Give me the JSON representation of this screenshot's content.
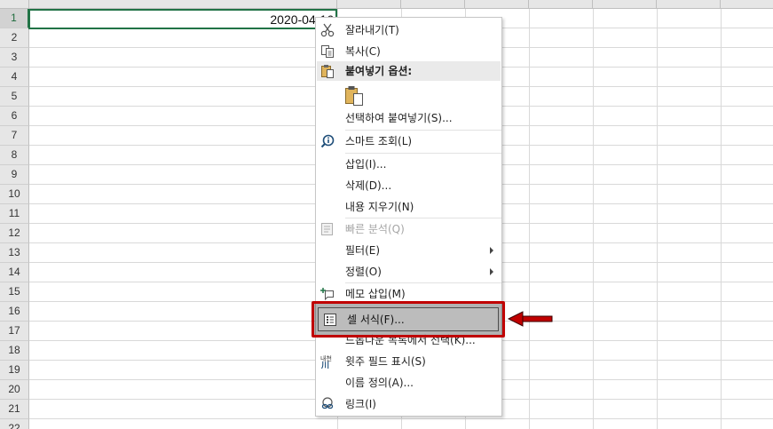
{
  "sheet": {
    "column_headers": [
      "",
      "",
      "",
      "",
      "",
      "",
      "",
      "",
      ""
    ],
    "row_numbers": [
      "1",
      "2",
      "3",
      "4",
      "5",
      "6",
      "7",
      "8",
      "9",
      "10",
      "11",
      "12",
      "13",
      "14",
      "15",
      "16",
      "17",
      "18",
      "19",
      "20",
      "21",
      "22"
    ],
    "active_cell_value": "2020-04-16"
  },
  "context_menu": {
    "cut": "잘라내기(T)",
    "copy": "복사(C)",
    "paste_options": "붙여넣기 옵션:",
    "paste_special": "선택하여 붙여넣기(S)...",
    "smart_lookup": "스마트 조회(L)",
    "insert": "삽입(I)...",
    "delete": "삭제(D)...",
    "clear_contents": "내용 지우기(N)",
    "quick_analysis": "빠른 분석(Q)",
    "filter": "필터(E)",
    "sort": "정렬(O)",
    "insert_comment": "메모 삽입(M)",
    "format_cells": "셀 서식(F)...",
    "pick_from_list": "드롭다운 목록에서 선택(K)...",
    "phonetic_field": "윗주 필드 표시(S)",
    "define_name": "이름 정의(A)...",
    "link": "링크(I)"
  },
  "icons": {
    "cut": "scissors-icon",
    "copy": "copy-icon",
    "paste_options": "clipboard-icon",
    "paste_button": "paste-clipboard-icon",
    "smart_lookup": "smart-lookup-icon",
    "quick_analysis": "quick-analysis-icon",
    "insert_comment": "new-comment-icon",
    "format_cells": "format-cells-icon",
    "phonetic_field": "phonetic-guide-icon",
    "link": "link-icon"
  },
  "colors": {
    "accent_green": "#217346",
    "highlight_red": "#c00000",
    "arrow_red": "#c00000"
  }
}
